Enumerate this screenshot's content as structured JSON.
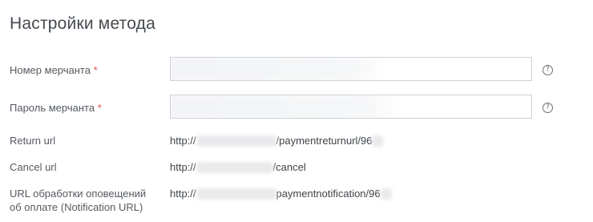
{
  "page": {
    "title": "Настройки метода"
  },
  "fields": {
    "merchant_number": {
      "label": "Номер мерчанта",
      "required_mark": "*",
      "value": ""
    },
    "merchant_password": {
      "label": "Пароль мерчанта",
      "required_mark": "*",
      "value": ""
    }
  },
  "help_icon": {
    "glyph": "?",
    "icon": "question-circle-icon"
  },
  "urls": {
    "return": {
      "label": "Return url",
      "prefix": "http://",
      "suffix": "/paymentreturnurl/96"
    },
    "cancel": {
      "label": "Cancel url",
      "prefix": "http://",
      "suffix": "/cancel"
    },
    "notification": {
      "label_line1": "URL обработки оповещений",
      "label_line2": "об оплате (Notification URL)",
      "prefix": "http://",
      "suffix": "paymentnotification/96"
    }
  },
  "colors": {
    "required": "#d9534f",
    "border": "#cdd1d6"
  }
}
